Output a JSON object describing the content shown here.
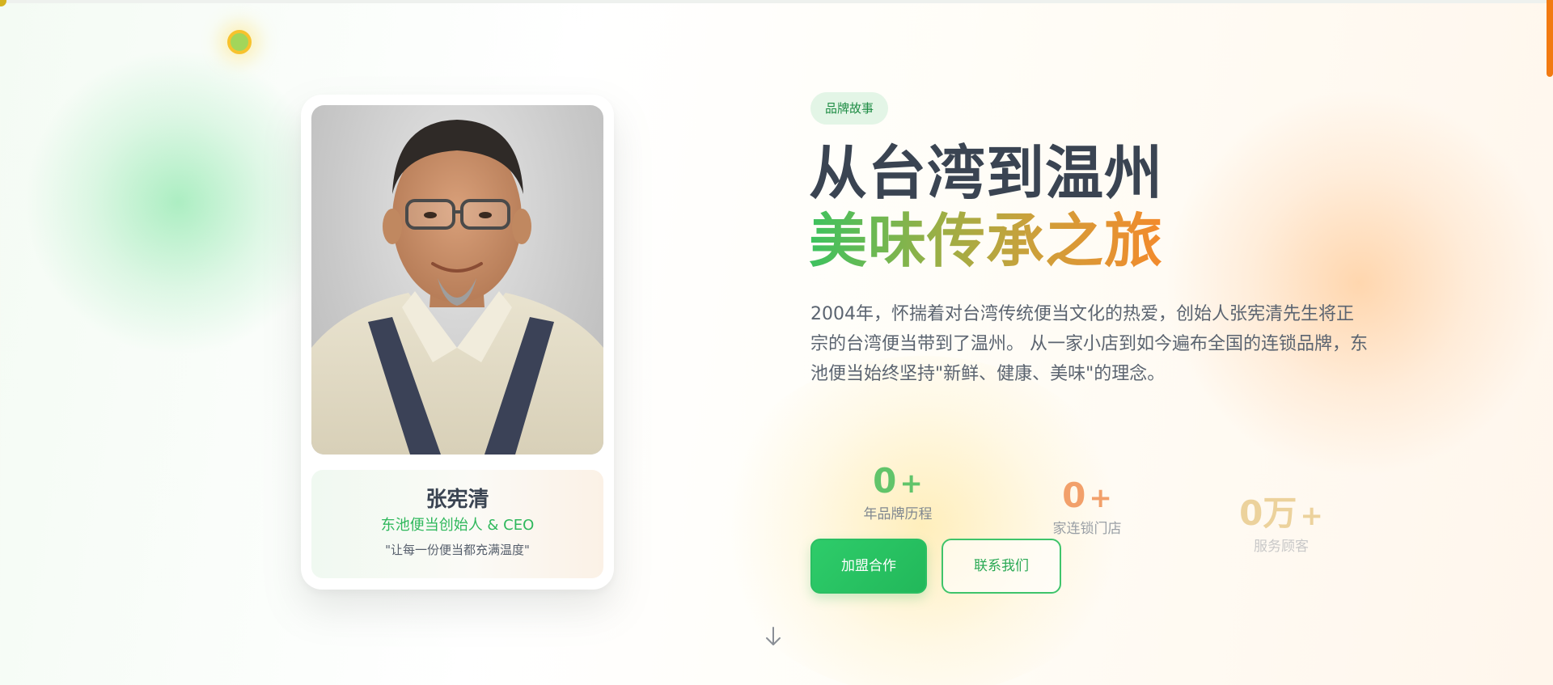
{
  "badge": "品牌故事",
  "heading": {
    "line1": "从台湾到温州",
    "line2": "美味传承之旅"
  },
  "description": "2004年，怀揣着对台湾传统便当文化的热爱，创始人张宪清先生将正宗的台湾便当带到了温州。 从一家小店到如今遍布全国的连锁品牌，东池便当始终坚持\"新鲜、健康、美味\"的理念。",
  "founder": {
    "name": "张宪清",
    "title": "东池便当创始人 & CEO",
    "quote": "\"让每一份便当都充满温度\""
  },
  "stats": [
    {
      "value": "0",
      "suffix": "+",
      "label": "年品牌历程"
    },
    {
      "value": "0",
      "suffix": "+",
      "label": "家连锁门店"
    },
    {
      "value": "0万",
      "suffix": "+",
      "label": "服务顾客"
    }
  ],
  "buttons": {
    "primary": "加盟合作",
    "secondary": "联系我们"
  },
  "icons": {
    "scroll": "arrow-down-icon",
    "cursor": "cursor-highlight-dot"
  },
  "colors": {
    "brand_green": "#2fb85c",
    "brand_orange": "#f38a2c",
    "heading_dark": "#3a4452",
    "scrollbar": "#f27a12"
  }
}
